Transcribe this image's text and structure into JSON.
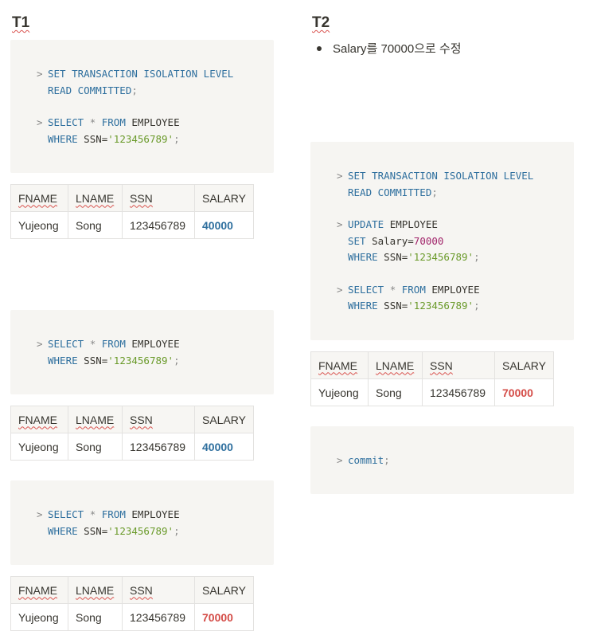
{
  "t1": {
    "heading": "T1",
    "block1": {
      "line1": "SET TRANSACTION ISOLATION LEVEL",
      "line2": "READ COMMITTED",
      "select_kw": "SELECT",
      "star": "*",
      "from_kw": "FROM",
      "table": "EMPLOYEE",
      "where_kw": "WHERE",
      "ssn_eq": "SSN=",
      "ssn_val": "'123456789'"
    },
    "block2": {
      "select_kw": "SELECT",
      "star": "*",
      "from_kw": "FROM",
      "table": "EMPLOYEE",
      "where_kw": "WHERE",
      "ssn_eq": "SSN=",
      "ssn_val": "'123456789'"
    },
    "block3": {
      "select_kw": "SELECT",
      "star": "*",
      "from_kw": "FROM",
      "table": "EMPLOYEE",
      "where_kw": "WHERE",
      "ssn_eq": "SSN=",
      "ssn_val": "'123456789'"
    },
    "result1": {
      "fname": "Yujeong",
      "lname": "Song",
      "ssn": "123456789",
      "salary": "40000"
    },
    "result2": {
      "fname": "Yujeong",
      "lname": "Song",
      "ssn": "123456789",
      "salary": "40000"
    },
    "result3": {
      "fname": "Yujeong",
      "lname": "Song",
      "ssn": "123456789",
      "salary": "70000"
    }
  },
  "t2": {
    "heading": "T2",
    "bullet": "Salary를 70000으로 수정",
    "block1": {
      "line1": "SET TRANSACTION ISOLATION LEVEL",
      "line2": "READ COMMITTED",
      "update_kw": "UPDATE",
      "table": "EMPLOYEE",
      "set_kw": "SET",
      "salary_eq": "Salary=",
      "salary_val": "70000",
      "where_kw": "WHERE",
      "ssn_eq": "SSN=",
      "ssn_val": "'123456789'",
      "select_kw": "SELECT",
      "star": "*",
      "from_kw": "FROM"
    },
    "result": {
      "fname": "Yujeong",
      "lname": "Song",
      "ssn": "123456789",
      "salary": "70000"
    },
    "commit": "commit"
  },
  "columns": {
    "fname": "FNAME",
    "lname": "LNAME",
    "ssn": "SSN",
    "salary": "SALARY"
  },
  "colors": {
    "keyword": "#2e6f9e",
    "string": "#6a9a2a",
    "number": "#a1246a",
    "salary_old": "#2e6f9e",
    "salary_new": "#d44c47",
    "code_bg": "#f6f5f2"
  }
}
